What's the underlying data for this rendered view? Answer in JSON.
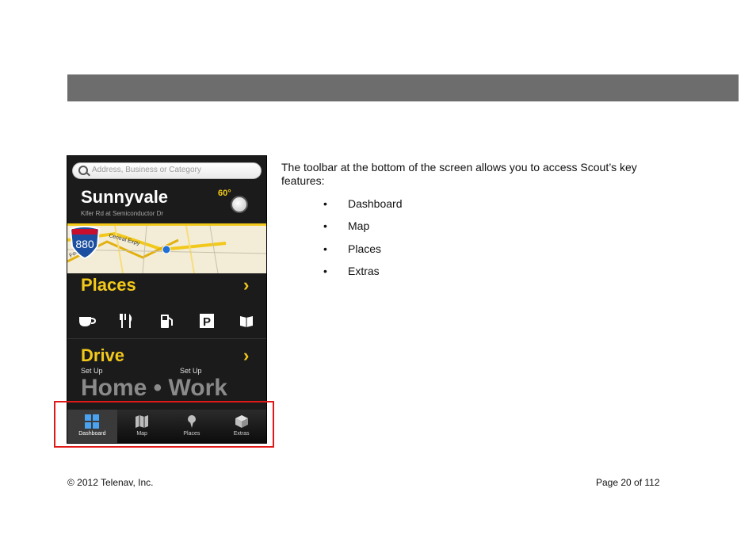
{
  "phone": {
    "search_placeholder": "Address, Business or Category",
    "city": "Sunnyvale",
    "street": "Kifer Rd at Semiconductor Dr",
    "temperature": "60°",
    "map": {
      "road_labels": [
        "Central Expy",
        "Foothill Expy"
      ],
      "highway_number": "880"
    },
    "places": {
      "title": "Places",
      "chevron": "›",
      "icons": [
        "coffee-icon",
        "restaurant-icon",
        "gas-station-icon",
        "parking-icon",
        "more-icon"
      ]
    },
    "drive": {
      "title": "Drive",
      "chevron": "›",
      "setup_home": "Set Up",
      "setup_work": "Set Up",
      "destinations": "Home • Work"
    },
    "tabbar": {
      "tabs": [
        {
          "label": "Dashboard",
          "icon": "grid-icon",
          "active": true
        },
        {
          "label": "Map",
          "icon": "map-icon",
          "active": false
        },
        {
          "label": "Places",
          "icon": "pin-icon",
          "active": false
        },
        {
          "label": "Extras",
          "icon": "box-icon",
          "active": false
        }
      ]
    },
    "colors": {
      "accent": "#f2c81a",
      "background": "#1b1b1b",
      "highlight_border": "#e01818"
    }
  },
  "content": {
    "intro": "The toolbar at the bottom of the screen allows you to access Scout’s key features:",
    "bullets": [
      "Dashboard",
      "Map",
      "Places",
      "Extras"
    ]
  },
  "footer": {
    "copyright": "© 2012 Telenav, Inc.",
    "page": "Page 20 of 112"
  }
}
